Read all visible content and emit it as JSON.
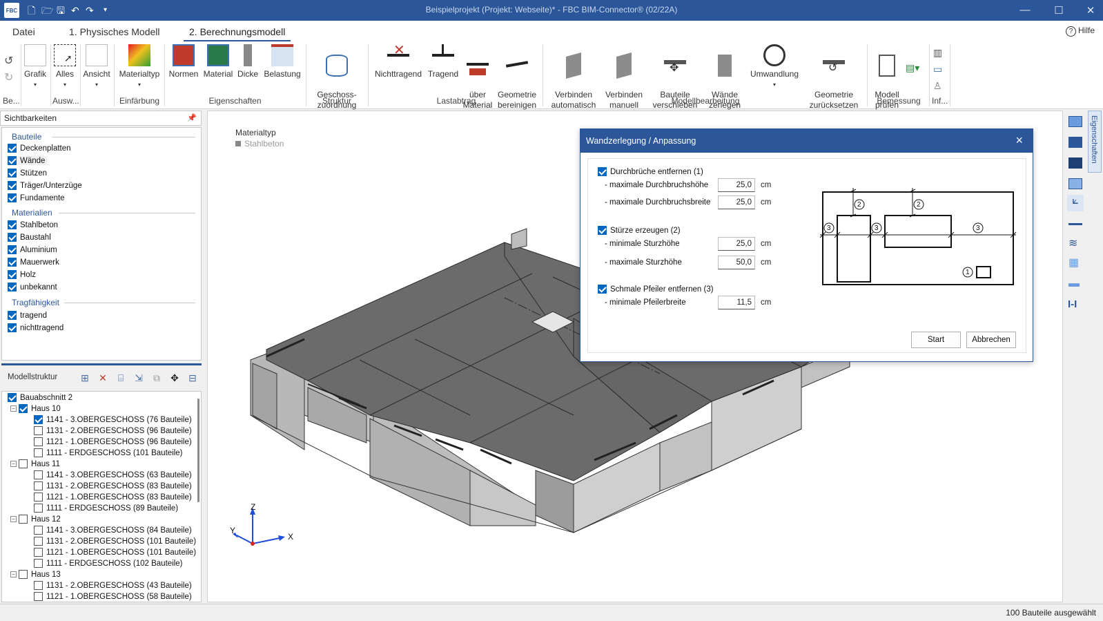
{
  "app": {
    "title": "Beispielprojekt (Projekt: Webseite)* - FBC BIM-Connector® (02/22A)",
    "logo": "FBC"
  },
  "tabs": [
    "Datei",
    "1. Physisches Modell",
    "2. Berechnungsmodell"
  ],
  "help": "Hilfe",
  "ribbon": {
    "buttons": {
      "grafik": "Grafik",
      "alles": "Alles",
      "ansicht": "Ansicht",
      "materialtyp": "Materialtyp",
      "normen": "Normen",
      "material": "Material",
      "dicke": "Dicke",
      "belastung": "Belastung",
      "geschoss": "Geschoss-\nzuordnung",
      "nichttragend": "Nichttragend",
      "tragend": "Tragend",
      "uebermaterial": "über\nMaterial",
      "geometrie": "Geometrie\nbereinigen",
      "verbinden_auto": "Verbinden\nautomatisch",
      "verbinden_man": "Verbinden\nmanuell",
      "bauteile_versch": "Bauteile\nverschieben",
      "waende_zerlegen": "Wände\nzerlegen",
      "umwandlung": "Umwandlung",
      "geometrie_zurueck": "Geometrie\nzurücksetzen",
      "modell_pruefen": "Modell\nprüfen"
    },
    "groups": {
      "be": "Be...",
      "ausw": "Ausw...",
      "einfaerbung": "Einfärbung",
      "eigenschaften": "Eigenschaften",
      "struktur": "Struktur",
      "lastabtrag": "Lastabtrag",
      "modellbearbeitung": "Modellbearbeitung",
      "bemessung": "Bemessung",
      "inf": "Inf..."
    }
  },
  "visibility": {
    "header": "Sichtbarkeiten",
    "sections": {
      "bauteile": "Bauteile",
      "materialien": "Materialien",
      "tragfaehigkeit": "Tragfähigkeit"
    },
    "bauteile": [
      "Deckenplatten",
      "Wände",
      "Stützen",
      "Träger/Unterzüge",
      "Fundamente"
    ],
    "materialien": [
      "Stahlbeton",
      "Baustahl",
      "Aluminium",
      "Mauerwerk",
      "Holz",
      "unbekannt"
    ],
    "tragfaehigkeit": [
      "tragend",
      "nichttragend"
    ]
  },
  "model": {
    "header": "Modellstruktur",
    "tree": [
      "Bauabschnitt 2",
      "Haus 10",
      "1141 - 3.OBERGESCHOSS (76 Bauteile)",
      "1131 - 2.OBERGESCHOSS (96 Bauteile)",
      "1121 - 1.OBERGESCHOSS (96 Bauteile)",
      "1111 - ERDGESCHOSS (101 Bauteile)",
      "Haus 11",
      "1141 - 3.OBERGESCHOSS (63 Bauteile)",
      "1131 - 2.OBERGESCHOSS (83 Bauteile)",
      "1121 - 1.OBERGESCHOSS (83 Bauteile)",
      "1111 - ERDGESCHOSS (89 Bauteile)",
      "Haus 12",
      "1141 - 3.OBERGESCHOSS (84 Bauteile)",
      "1131 - 2.OBERGESCHOSS (101 Bauteile)",
      "1121 - 1.OBERGESCHOSS (101 Bauteile)",
      "1111 - ERDGESCHOSS (102 Bauteile)",
      "Haus 13",
      "1131 - 2.OBERGESCHOSS (43 Bauteile)",
      "1121 - 1.OBERGESCHOSS (58 Bauteile)"
    ]
  },
  "viewport": {
    "material_label": "Materialtyp",
    "material_value": "Stahlbeton",
    "axes": {
      "x": "X",
      "y": "Y",
      "z": "Z"
    }
  },
  "side_tab": "Eigenschaften",
  "status": "100 Bauteile ausgewählt",
  "dialog": {
    "title": "Wandzerlegung / Anpassung",
    "opt1": "Durchbrüche entfernen (1)",
    "opt1_a": "- maximale Durchbruchshöhe",
    "opt1_a_val": "25,0",
    "opt1_b": "- maximale Durchbruchsbreite",
    "opt1_b_val": "25,0",
    "opt2": "Stürze erzeugen (2)",
    "opt2_a": "- minimale Sturzhöhe",
    "opt2_a_val": "25,0",
    "opt2_b": "- maximale Sturzhöhe",
    "opt2_b_val": "50,0",
    "opt3": "Schmale Pfeiler entfernen (3)",
    "opt3_a": "- minimale Pfeilerbreite",
    "opt3_a_val": "11,5",
    "unit": "cm",
    "diagram": {
      "n1": "1",
      "n2": "2",
      "n3": "3"
    },
    "start": "Start",
    "cancel": "Abbrechen"
  },
  "colors": {
    "accent": "#2b579a",
    "check": "#0067c0",
    "slab": "#6b6b6b",
    "wall": "#a8a8a8"
  }
}
